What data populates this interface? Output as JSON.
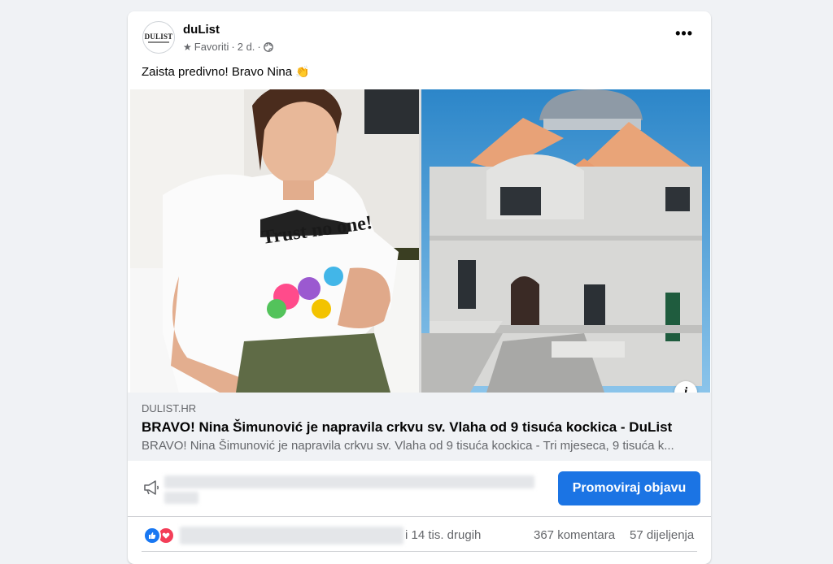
{
  "post": {
    "page_name": "duList",
    "avatar_logo": "DULIST",
    "meta": {
      "favorites": "Favoriti",
      "time": "2 d.",
      "separator": "·",
      "audience_icon": "globe-icon"
    },
    "caption": "Zaista predivno! Bravo Nina",
    "caption_emoji": "👏",
    "more_icon": "•••"
  },
  "link_preview": {
    "domain": "DULIST.HR",
    "title": "BRAVO! Nina Šimunović je napravila crkvu sv. Vlaha od 9 tisuća kockica - DuList",
    "description": "BRAVO! Nina Šimunović je napravila crkvu sv. Vlaha od 9 tisuća kockica - Tri mjeseca, 9 tisuća k...",
    "info_icon": "i"
  },
  "promote": {
    "button_label": "Promoviraj objavu",
    "icon": "megaphone-icon"
  },
  "reactions": {
    "others_text": "i 14 tis. drugih",
    "comments": "367 komentara",
    "shares": "57 dijeljenja",
    "icons": [
      "like-icon",
      "love-icon"
    ]
  },
  "colors": {
    "accent": "#1b74e4",
    "like": "#1877f2",
    "love": "#f33e58",
    "background": "#f0f2f5"
  }
}
